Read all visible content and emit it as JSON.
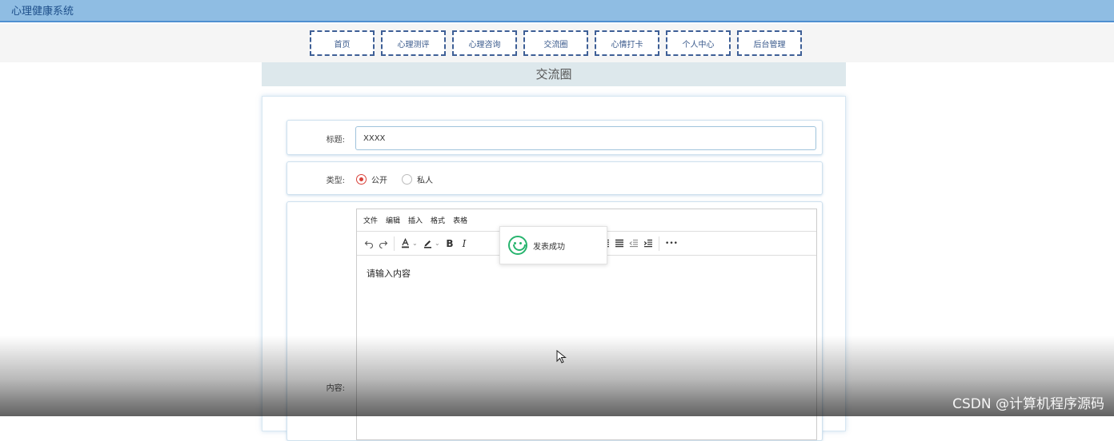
{
  "app": {
    "title": "心理健康系统"
  },
  "nav": {
    "items": [
      {
        "label": "首页"
      },
      {
        "label": "心理测评"
      },
      {
        "label": "心理咨询"
      },
      {
        "label": "交流圈"
      },
      {
        "label": "心情打卡"
      },
      {
        "label": "个人中心"
      },
      {
        "label": "后台管理"
      }
    ]
  },
  "page": {
    "section_title": "交流圈"
  },
  "form": {
    "title_label": "标题:",
    "title_value": "XXXX",
    "type_label": "类型:",
    "type_options": [
      {
        "label": "公开",
        "checked": true
      },
      {
        "label": "私人",
        "checked": false
      }
    ],
    "content_label": "内容:"
  },
  "editor": {
    "menu": [
      "文件",
      "编辑",
      "插入",
      "格式",
      "表格"
    ],
    "toolbar": {
      "bold": "B",
      "italic": "I",
      "more": "•••"
    },
    "placeholder": "请输入内容"
  },
  "toast": {
    "message": "发表成功",
    "color": "#27b46e"
  },
  "watermark": {
    "text": "CSDN @计算机程序源码"
  },
  "colors": {
    "topbar": "#8fbde3",
    "nav_border": "#3e5f96",
    "radio_checked": "#d9423a"
  }
}
